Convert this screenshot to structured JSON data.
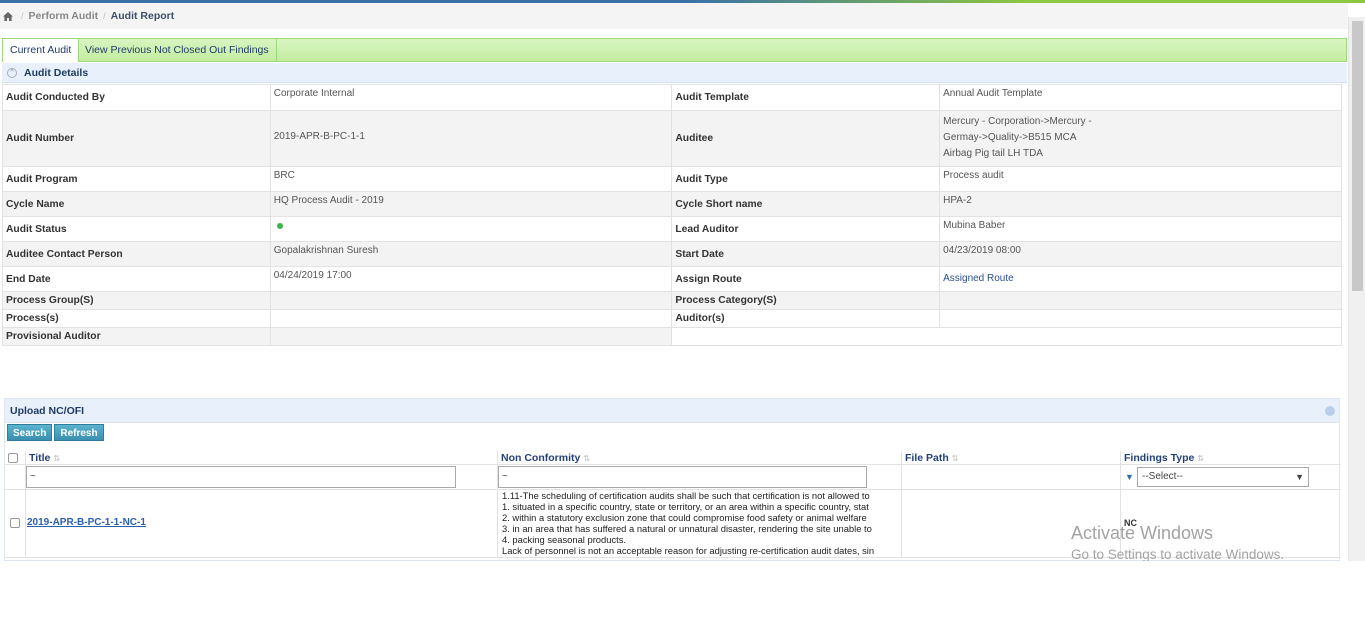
{
  "breadcrumb": {
    "items": [
      "Perform Audit",
      "Audit Report"
    ]
  },
  "tabs": [
    {
      "label": "Current Audit"
    },
    {
      "label": "View Previous Not Closed Out Findings"
    }
  ],
  "audit_details": {
    "header": "Audit Details",
    "rows": [
      {
        "l1": "Audit Conducted By",
        "v1": "Corporate Internal",
        "l2": "Audit Template",
        "v2": "Annual Audit Template"
      },
      {
        "l1": "Audit Number",
        "v1": "2019-APR-B-PC-1-1",
        "l2": "Auditee",
        "v2": "Mercury - Corporation->Mercury - Germay->Quality->B515 MCA Airbag Pig tail LH TDA"
      },
      {
        "l1": "Audit Program",
        "v1": "BRC",
        "l2": "Audit Type",
        "v2": "Process audit"
      },
      {
        "l1": "Cycle Name",
        "v1": "HQ Process Audit - 2019",
        "l2": "Cycle Short name",
        "v2": "HPA-2"
      },
      {
        "l1": "Audit Status",
        "v1": "",
        "l2": "Lead Auditor",
        "v2": "Mubina Baber"
      },
      {
        "l1": "Auditee Contact Person",
        "v1": "Gopalakrishnan Suresh",
        "l2": "Start Date",
        "v2": "04/23/2019 08:00"
      },
      {
        "l1": "End Date",
        "v1": "04/24/2019 17:00",
        "l2": "Assign Route",
        "v2": "Assigned Route"
      },
      {
        "l1": "Process Group(S)",
        "v1": "",
        "l2": "Process Category(S)",
        "v2": ""
      },
      {
        "l1": "Process(s)",
        "v1": "",
        "l2": "Auditor(s)",
        "v2": ""
      },
      {
        "l1": "Provisional Auditor",
        "v1": ""
      }
    ],
    "status_color": "#3cb44a"
  },
  "upload": {
    "header": "Upload NC/OFI",
    "search_label": "Search",
    "refresh_label": "Refresh",
    "columns": [
      "Title",
      "Non Conformity",
      "File Path",
      "Findings Type"
    ],
    "filter_title": "~",
    "filter_nc": "~",
    "filter_findings": "--Select--",
    "row": {
      "title": "2019-APR-B-PC-1-1-NC-1",
      "nc_lines": [
        "1.11-The scheduling of certification audits shall be such that certification is not allowed to",
        " 1. situated in a specific country, state or territory, or an area within a specific country, stat",
        " 2. within a statutory exclusion zone that could compromise food safety or animal welfare",
        " 3. in an area that has suffered a natural or unnatural disaster, rendering the site unable to",
        " 4. packing seasonal products.",
        " Lack of personnel is not an acceptable reason for adjusting re-certification audit dates, sin"
      ],
      "file_path": "",
      "findings_type": "NC"
    }
  },
  "watermark": {
    "line1": "Activate Windows",
    "line2": "Go to Settings to activate Windows."
  }
}
